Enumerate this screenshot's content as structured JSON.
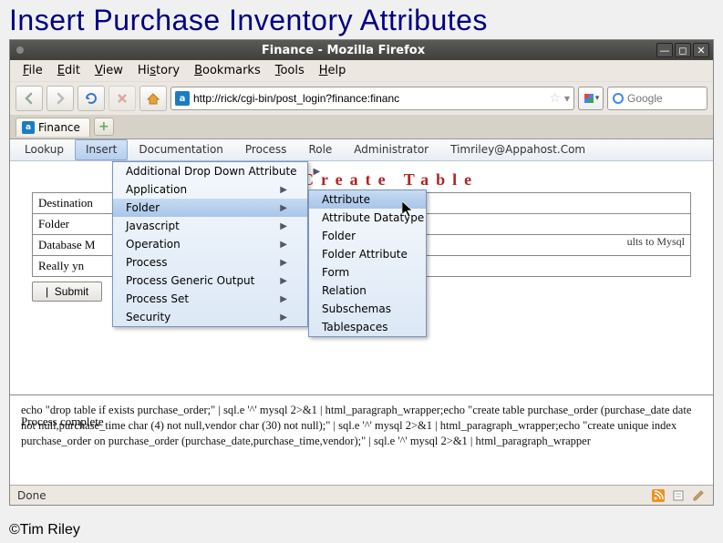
{
  "slide_title": "Insert Purchase Inventory Attributes",
  "window": {
    "title": "Finance - Mozilla Firefox",
    "menubar": [
      "File",
      "Edit",
      "View",
      "History",
      "Bookmarks",
      "Tools",
      "Help"
    ],
    "url": "http://rick/cgi-bin/post_login?finance:financ",
    "search_placeholder": "Google",
    "tab_label": "Finance"
  },
  "appmenu": {
    "items": [
      "Lookup",
      "Insert",
      "Documentation",
      "Process",
      "Role",
      "Administrator",
      "Timriley@Appahost.Com"
    ],
    "active_index": 1
  },
  "page_heading": "Create Table",
  "form": {
    "rows": [
      "Destination",
      "Folder",
      "Database M",
      "Really yn"
    ],
    "submit_label": "Submit",
    "note": "ults to Mysql"
  },
  "submenu1": {
    "items": [
      "Additional Drop Down Attribute",
      "Application",
      "Folder",
      "Javascript",
      "Operation",
      "Process",
      "Process Generic Output",
      "Process Set",
      "Security"
    ],
    "hot_index": 2
  },
  "submenu2": {
    "items": [
      "Attribute",
      "Attribute Datatype",
      "Folder",
      "Folder Attribute",
      "Form",
      "Relation",
      "Subschemas",
      "Tablespaces"
    ],
    "hot_index": 0
  },
  "output": {
    "text": "echo \"drop table if exists purchase_order;\" | sql.e '^' mysql 2>&1 | html_paragraph_wrapper;echo \"create table purchase_order (purchase_date date not null,purchase_time char (4) not null,vendor char (30) not null);\" | sql.e '^' mysql 2>&1 | html_paragraph_wrapper;echo \"create unique index purchase_order on purchase_order (purchase_date,purchase_time,vendor);\" | sql.e '^' mysql 2>&1 | html_paragraph_wrapper",
    "done": "Process complete"
  },
  "statusbar": {
    "text": "Done"
  },
  "copyright": "©Tim Riley"
}
